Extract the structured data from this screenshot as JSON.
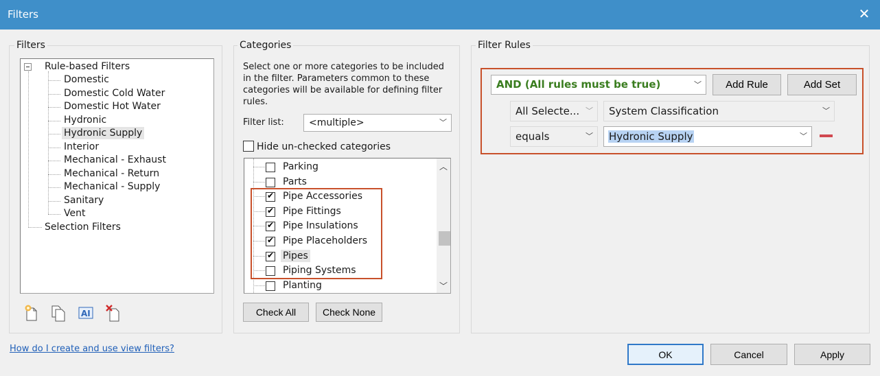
{
  "window": {
    "title": "Filters",
    "close_glyph": "✕"
  },
  "filters_panel": {
    "title": "Filters",
    "root_label": "Rule-based Filters",
    "items": [
      "Domestic",
      "Domestic Cold Water",
      "Domestic Hot Water",
      "Hydronic",
      "Hydronic Supply",
      "Interior",
      "Mechanical - Exhaust",
      "Mechanical - Return",
      "Mechanical - Supply",
      "Sanitary",
      "Vent"
    ],
    "selected_item": "Hydronic Supply",
    "selection_label": "Selection Filters",
    "toolbar_icons": [
      "new-filter-icon",
      "duplicate-filter-icon",
      "rename-filter-icon",
      "delete-filter-icon"
    ]
  },
  "help_link": "How do I create and use view filters?",
  "categories_panel": {
    "title": "Categories",
    "description": "Select one or more categories to be included in the filter.  Parameters common to these categories will be available for defining filter rules.",
    "filter_list_label": "Filter list:",
    "filter_list_value": "<multiple>",
    "hide_unchecked_label": "Hide un-checked categories",
    "hide_unchecked": false,
    "items": [
      {
        "label": "Parking",
        "checked": false
      },
      {
        "label": "Parts",
        "checked": false
      },
      {
        "label": "Pipe Accessories",
        "checked": true
      },
      {
        "label": "Pipe Fittings",
        "checked": true
      },
      {
        "label": "Pipe Insulations",
        "checked": true
      },
      {
        "label": "Pipe Placeholders",
        "checked": true
      },
      {
        "label": "Pipes",
        "checked": true,
        "selected": true
      },
      {
        "label": "Piping Systems",
        "checked": false
      },
      {
        "label": "Planting",
        "checked": false
      }
    ],
    "check_all": "Check All",
    "check_none": "Check None"
  },
  "rules_panel": {
    "title": "Filter Rules",
    "logic": "AND (All rules must be true)",
    "add_rule": "Add Rule",
    "add_set": "Add Set",
    "category_scope": "All Selecte...",
    "parameter": "System Classification",
    "operator": "equals",
    "value": "Hydronic Supply"
  },
  "footer": {
    "ok": "OK",
    "cancel": "Cancel",
    "apply": "Apply"
  },
  "colors": {
    "titlebar": "#3f8fc9",
    "highlight_box": "#c8502a",
    "logic_text": "#3a7d1f",
    "remove_rule": "#d14850"
  }
}
